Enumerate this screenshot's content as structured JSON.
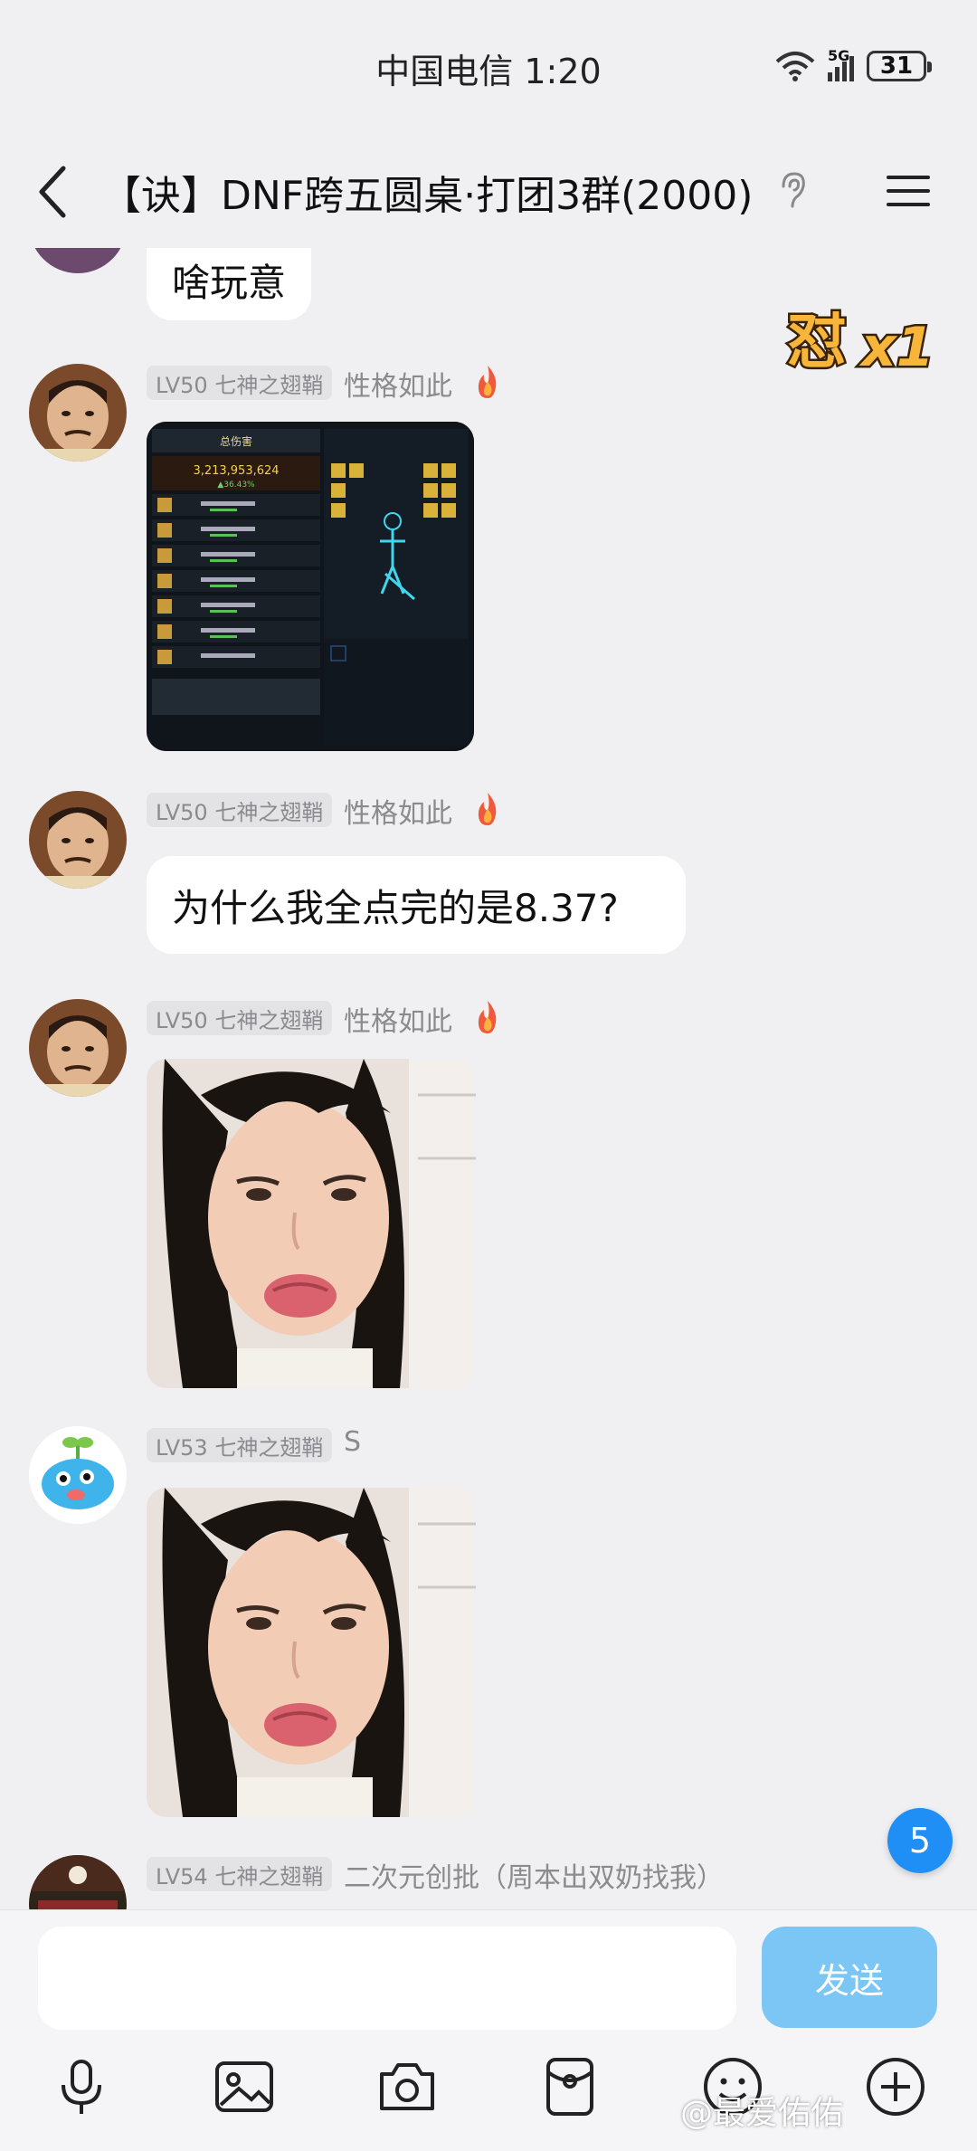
{
  "status_bar": {
    "carrier_time": "中国电信 1:20",
    "network": "5G",
    "battery": "31"
  },
  "header": {
    "title": "【诀】DNF跨五圆桌·打团3群(2000)"
  },
  "combo_sticker": {
    "text": "怼",
    "multiplier": "x1"
  },
  "messages": [
    {
      "type": "text",
      "text": "啥玩意"
    },
    {
      "type": "image",
      "level": "LV50 七神之翅鞘",
      "nickname": "性格如此",
      "image_desc": "game-equipment-screenshot",
      "game": {
        "tab_title": "总伤害",
        "total": "3,213,953,624",
        "total_pct": "▲36.43%"
      }
    },
    {
      "type": "text",
      "level": "LV50 七神之翅鞘",
      "nickname": "性格如此",
      "text": "为什么我全点完的是8.37?"
    },
    {
      "type": "image",
      "level": "LV50 七神之翅鞘",
      "nickname": "性格如此",
      "image_desc": "crying-face-sticker"
    },
    {
      "type": "image",
      "level": "LV53 七神之翅鞘",
      "nickname": "S",
      "image_desc": "crying-face-sticker"
    },
    {
      "type": "partial",
      "level": "LV54 七神之翅鞘",
      "nickname": "二次元创批（周本出双奶找我）"
    }
  ],
  "unread_count": "5",
  "input": {
    "placeholder": "",
    "send_label": "发送"
  },
  "toolbar": [
    "mic-icon",
    "image-icon",
    "camera-icon",
    "red-packet-icon",
    "emoji-icon",
    "plus-icon"
  ],
  "watermark": "@最爱佑佑"
}
